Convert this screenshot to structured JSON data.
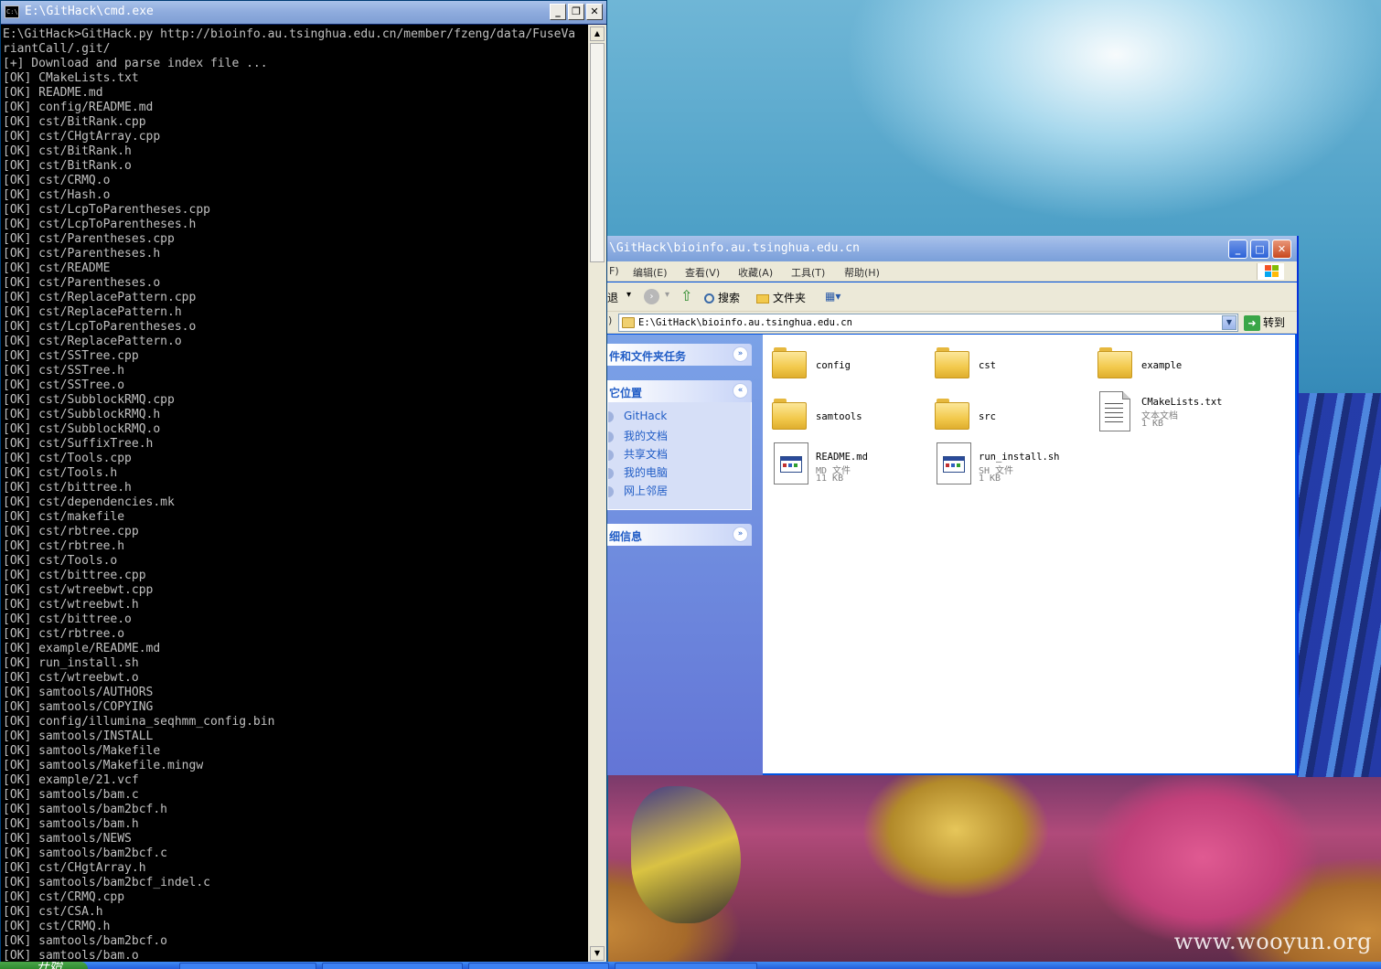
{
  "cmd": {
    "title": "E:\\GitHack\\cmd.exe",
    "icon_label": "C:\\",
    "buttons": {
      "minimize": "_",
      "restore": "❐",
      "close": "✕"
    },
    "lines": [
      "E:\\GitHack>GitHack.py http://bioinfo.au.tsinghua.edu.cn/member/fzeng/data/FuseVa",
      "riantCall/.git/",
      "[+] Download and parse index file ...",
      "[OK] CMakeLists.txt",
      "[OK] README.md",
      "[OK] config/README.md",
      "[OK] cst/BitRank.cpp",
      "[OK] cst/CHgtArray.cpp",
      "[OK] cst/BitRank.h",
      "[OK] cst/BitRank.o",
      "[OK] cst/CRMQ.o",
      "[OK] cst/Hash.o",
      "[OK] cst/LcpToParentheses.cpp",
      "[OK] cst/LcpToParentheses.h",
      "[OK] cst/Parentheses.cpp",
      "[OK] cst/Parentheses.h",
      "[OK] cst/README",
      "[OK] cst/Parentheses.o",
      "[OK] cst/ReplacePattern.cpp",
      "[OK] cst/ReplacePattern.h",
      "[OK] cst/LcpToParentheses.o",
      "[OK] cst/ReplacePattern.o",
      "[OK] cst/SSTree.cpp",
      "[OK] cst/SSTree.h",
      "[OK] cst/SSTree.o",
      "[OK] cst/SubblockRMQ.cpp",
      "[OK] cst/SubblockRMQ.h",
      "[OK] cst/SubblockRMQ.o",
      "[OK] cst/SuffixTree.h",
      "[OK] cst/Tools.cpp",
      "[OK] cst/Tools.h",
      "[OK] cst/bittree.h",
      "[OK] cst/dependencies.mk",
      "[OK] cst/makefile",
      "[OK] cst/rbtree.cpp",
      "[OK] cst/rbtree.h",
      "[OK] cst/Tools.o",
      "[OK] cst/bittree.cpp",
      "[OK] cst/wtreebwt.cpp",
      "[OK] cst/wtreebwt.h",
      "[OK] cst/bittree.o",
      "[OK] cst/rbtree.o",
      "[OK] example/README.md",
      "[OK] run_install.sh",
      "[OK] cst/wtreebwt.o",
      "[OK] samtools/AUTHORS",
      "[OK] samtools/COPYING",
      "[OK] config/illumina_seqhmm_config.bin",
      "[OK] samtools/INSTALL",
      "[OK] samtools/Makefile",
      "[OK] samtools/Makefile.mingw",
      "[OK] example/21.vcf",
      "[OK] samtools/bam.c",
      "[OK] samtools/bam2bcf.h",
      "[OK] samtools/bam.h",
      "[OK] samtools/NEWS",
      "[OK] samtools/bam2bcf.c",
      "[OK] cst/CHgtArray.h",
      "[OK] samtools/bam2bcf_indel.c",
      "[OK] cst/CRMQ.cpp",
      "[OK] cst/CSA.h",
      "[OK] cst/CRMQ.h",
      "[OK] samtools/bam2bcf.o",
      "[OK] samtools/bam.o"
    ],
    "scroll": {
      "up": "▲",
      "down": "▼"
    }
  },
  "explorer": {
    "title": "\\GitHack\\bioinfo.au.tsinghua.edu.cn",
    "buttons": {
      "minimize": "_",
      "maximize": "□",
      "close": "✕"
    },
    "menu": [
      "F)",
      "编辑(E)",
      "查看(V)",
      "收藏(A)",
      "工具(T)",
      "帮助(H)"
    ],
    "toolbar": {
      "back": "退",
      "back_drop": "▾",
      "forward": "›",
      "forward_drop": "▾",
      "up": "⇧",
      "search": "搜索",
      "folders": "文件夹",
      "views": "▦▾"
    },
    "address": {
      "prefix": ")",
      "value": "E:\\GitHack\\bioinfo.au.tsinghua.edu.cn",
      "drop": "▼",
      "go_icon": "➜",
      "go": "转到"
    },
    "sidebar": {
      "tasks_title": "件和文件夹任务",
      "places_title": "它位置",
      "details_title": "细信息",
      "chev_down": "»",
      "chev_up": "«",
      "places": [
        "GitHack",
        "我的文档",
        "共享文档",
        "我的电脑",
        "网上邻居"
      ]
    },
    "files": [
      {
        "name": "config",
        "kind": "folder"
      },
      {
        "name": "cst",
        "kind": "folder"
      },
      {
        "name": "example",
        "kind": "folder"
      },
      {
        "name": "samtools",
        "kind": "folder"
      },
      {
        "name": "src",
        "kind": "folder"
      },
      {
        "name": "CMakeLists.txt",
        "type": "文本文档",
        "size": "1 KB",
        "kind": "doc"
      },
      {
        "name": "README.md",
        "type": "MD 文件",
        "size": "11 KB",
        "kind": "app"
      },
      {
        "name": "run_install.sh",
        "type": "SH 文件",
        "size": "1 KB",
        "kind": "app"
      }
    ]
  },
  "taskbar": {
    "start": "开始"
  },
  "watermark": "www.wooyun.org",
  "colors": {
    "xp_blue": "#0054e3",
    "cmd_text": "#c0c0c0",
    "link": "#215dc6"
  }
}
